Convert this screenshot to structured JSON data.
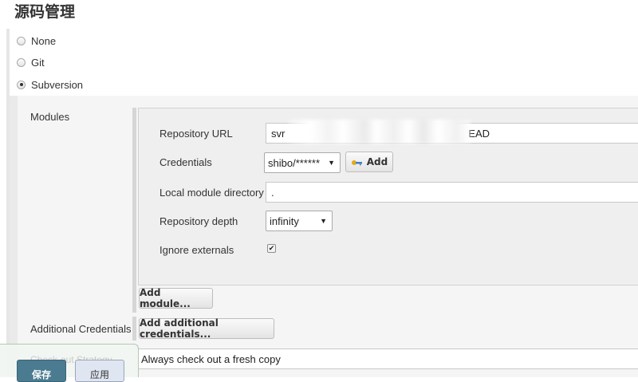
{
  "section_title": "源码管理",
  "scm_options": [
    {
      "label": "None",
      "checked": false
    },
    {
      "label": "Git",
      "checked": false
    },
    {
      "label": "Subversion",
      "checked": true
    }
  ],
  "modules": {
    "label": "Modules",
    "repository_url": {
      "label": "Repository URL",
      "value_start": "svr",
      "value_end": "EAD"
    },
    "credentials": {
      "label": "Credentials",
      "selected": "shibo/******",
      "add_label": "Add"
    },
    "local_module_directory": {
      "label": "Local module directory",
      "value": "."
    },
    "repository_depth": {
      "label": "Repository depth",
      "selected": "infinity"
    },
    "ignore_externals": {
      "label": "Ignore externals",
      "checked": true
    },
    "add_module_label": "Add module..."
  },
  "additional_credentials": {
    "label": "Additional Credentials",
    "button_label": "Add additional credentials..."
  },
  "checkout_strategy": {
    "label": "Check-out Strategy",
    "selected": "Always check out a fresh copy"
  },
  "footer": {
    "save_label": "保存",
    "apply_label": "应用"
  }
}
